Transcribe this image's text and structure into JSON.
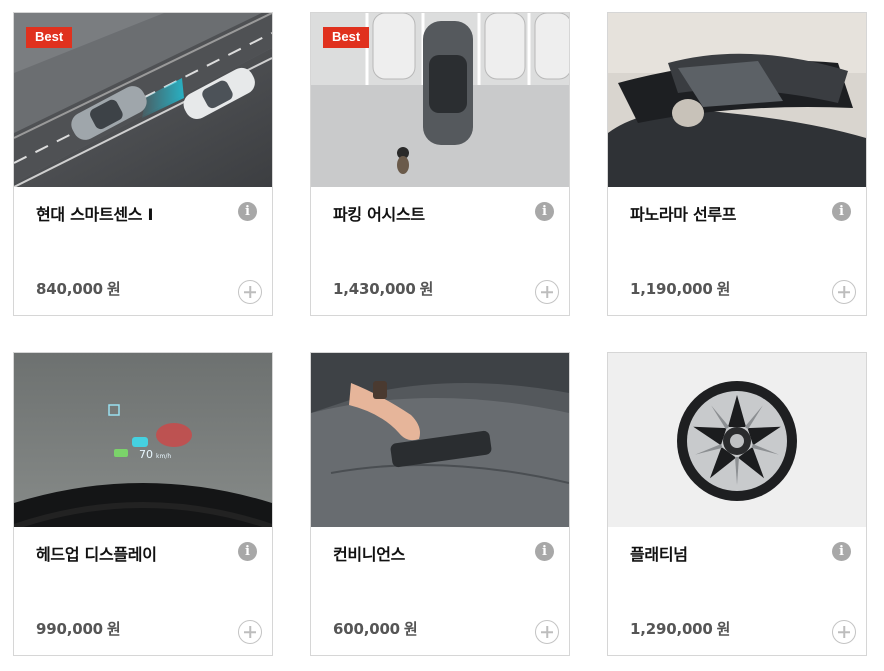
{
  "options": [
    {
      "title": "현대 스마트센스 I",
      "price": "840,000",
      "currency": "원",
      "badge": "Best",
      "info_icon": "info-icon",
      "add_icon": "plus-circle-icon"
    },
    {
      "title": "파킹 어시스트",
      "price": "1,430,000",
      "currency": "원",
      "badge": "Best",
      "info_icon": "info-icon",
      "add_icon": "plus-circle-icon"
    },
    {
      "title": "파노라마 선루프",
      "price": "1,190,000",
      "currency": "원",
      "badge": "",
      "info_icon": "info-icon",
      "add_icon": "plus-circle-icon"
    },
    {
      "title": "헤드업 디스플레이",
      "price": "990,000",
      "currency": "원",
      "badge": "",
      "info_icon": "info-icon",
      "add_icon": "plus-circle-icon"
    },
    {
      "title": "컨비니언스",
      "price": "600,000",
      "currency": "원",
      "badge": "",
      "info_icon": "info-icon",
      "add_icon": "plus-circle-icon"
    },
    {
      "title": "플래티넘",
      "price": "1,290,000",
      "currency": "원",
      "badge": "",
      "info_icon": "info-icon",
      "add_icon": "plus-circle-icon"
    }
  ],
  "hud": {
    "speed": "70",
    "unit": "km/h"
  },
  "colors": {
    "badge": "#e0311e",
    "info": "#a8a8a8",
    "border": "#d6d6d6"
  }
}
